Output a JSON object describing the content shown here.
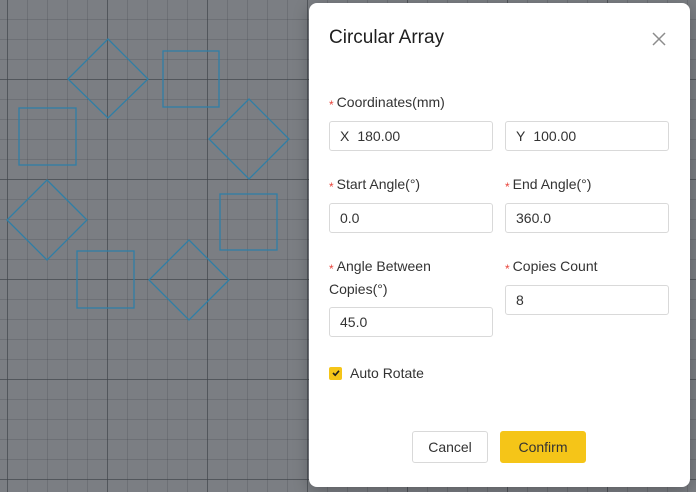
{
  "dialog": {
    "title": "Circular Array",
    "close_icon": "close-icon",
    "coordinates": {
      "label": "Coordinates(mm)",
      "x_prefix": "X",
      "x_value": "180.00",
      "y_prefix": "Y",
      "y_value": "100.00"
    },
    "start_angle": {
      "label": "Start Angle(°)",
      "value": "0.0"
    },
    "end_angle": {
      "label": "End Angle(°)",
      "value": "360.0"
    },
    "angle_between": {
      "label_line1": "Angle Between",
      "label_line2": "Copies(°)",
      "value": "45.0"
    },
    "copies_count": {
      "label": "Copies Count",
      "value": "8"
    },
    "auto_rotate": {
      "label": "Auto Rotate",
      "checked": true
    },
    "cancel_label": "Cancel",
    "confirm_label": "Confirm",
    "required_marker": "*",
    "accent_color": "#f5c518"
  },
  "canvas": {
    "shape_color": "#2f7fa6",
    "shape_count": 8
  }
}
